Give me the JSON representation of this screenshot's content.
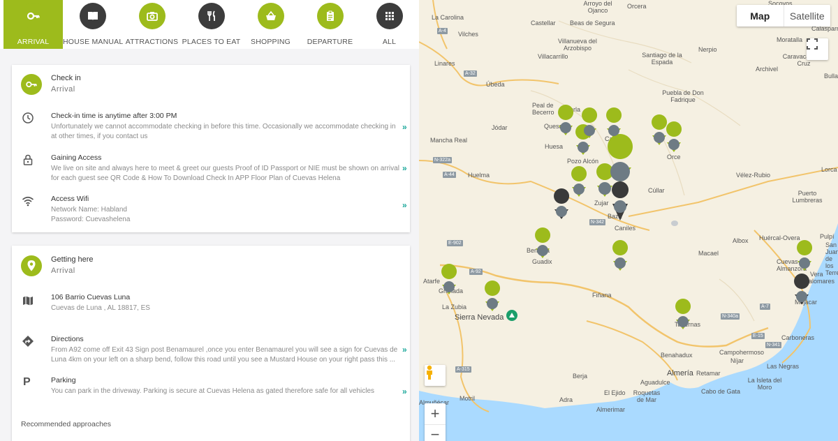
{
  "nav": {
    "items": [
      {
        "label": "ARRIVAL",
        "icon": "key-icon"
      },
      {
        "label": "HOUSE MANUAL",
        "icon": "book-icon"
      },
      {
        "label": "ATTRACTIONS",
        "icon": "camera-icon"
      },
      {
        "label": "PLACES TO EAT",
        "icon": "fork-knife-icon"
      },
      {
        "label": "SHOPPING",
        "icon": "basket-icon"
      },
      {
        "label": "DEPARTURE",
        "icon": "clipboard-icon"
      },
      {
        "label": "ALL",
        "icon": "grid-icon"
      }
    ]
  },
  "checkin": {
    "title": "Check in",
    "subtitle": "Arrival",
    "rows": [
      {
        "title": "Check-in time is anytime after 3:00 PM",
        "desc": "Unfortunately we cannot accommodate checking in before this time. Occasionally we accommodate checking in at other times, if you contact us",
        "icon": "clock-icon"
      },
      {
        "title": "Gaining Access",
        "desc": "We live on site and always here to meet & greet our guests Proof of ID Passport or NIE must be shown on arrival for each guest see QR Code & How To Download Check In APP Floor Plan of Cuevas Helena",
        "icon": "lock-icon"
      },
      {
        "title": "Access Wifi",
        "desc1": "Network Name: Habland",
        "desc2": "Password: Cuevashelena",
        "icon": "wifi-icon"
      }
    ]
  },
  "getting": {
    "title": "Getting here",
    "subtitle": "Arrival",
    "rows": [
      {
        "title": "106 Barrio Cuevas Luna",
        "desc": "Cuevas de Luna , AL 18817, ES",
        "icon": "map-icon"
      },
      {
        "title": "Directions",
        "desc": "From A92 come off Exit 43 Sign post Benamaurel ,once you enter Benamaurel you will see a sign for Cuevas de Luna 4km on your left on a sharp bend, follow this road until you see a Mustard House on your right pass this ...",
        "icon": "directions-icon"
      },
      {
        "title": "Parking",
        "desc": "You can park in the driveway. Parking is secure at Cuevas Helena as gated therefore safe for all vehicles",
        "icon": "parking-letter"
      }
    ],
    "recommended": "Recommended approaches"
  },
  "chevron": "»",
  "map": {
    "type_map": "Map",
    "type_satellite": "Satellite",
    "zoom_in": "+",
    "zoom_out": "−",
    "places": [
      "La Carolina",
      "Vilches",
      "Linares",
      "Úbeda",
      "Castellar",
      "Beas de Segura",
      "Villanueva del Arzobispo",
      "Villacarrillo",
      "Orcera",
      "Arroyo del Ojanco",
      "Santiago de la Espada",
      "Nerpio",
      "Moratalla",
      "Calasparra",
      "Caravaca de la Cruz",
      "Archivel",
      "Bullas",
      "Socovos",
      "Peal de Becerro",
      "Cazorla",
      "Jódar",
      "Quesada",
      "Huesa",
      "Castril",
      "Pozo Alcón",
      "Mancha Real",
      "Huelma",
      "Puebla de Don Fadrique",
      "Orce",
      "Vélez-Rubio",
      "Lorca",
      "Puerto Lumbreras",
      "Cúllar",
      "Zujar",
      "Baza",
      "Caniles",
      "Benalúa",
      "Guadix",
      "Albox",
      "Huércal-Overa",
      "Pulpí",
      "San Juan de los Terreros",
      "Macael",
      "Cuevas del Almanzora",
      "Palomares",
      "Vera",
      "Mojácar",
      "Atarfe",
      "Granada",
      "La Zubia",
      "Sierra Nevada",
      "Fiñana",
      "Tabernas",
      "Carboneras",
      "Benahadux",
      "Campohermoso",
      "Níjar",
      "Las Negras",
      "La Isleta del Moro",
      "Berja",
      "Aguadulce",
      "Almería",
      "Retamar",
      "Cabo de Gata",
      "El Ejido",
      "Roquetas de Mar",
      "Adra",
      "Motril",
      "Almuñécar",
      "Almerimar"
    ],
    "roads": [
      "A-4",
      "A-32",
      "N-322a",
      "A-44",
      "E-902",
      "A-92",
      "N-342",
      "N-340a",
      "A-7",
      "E-15",
      "N-341",
      "A-315"
    ],
    "pin_color": "#9dbb1c",
    "accent": "#9dbb1c"
  }
}
